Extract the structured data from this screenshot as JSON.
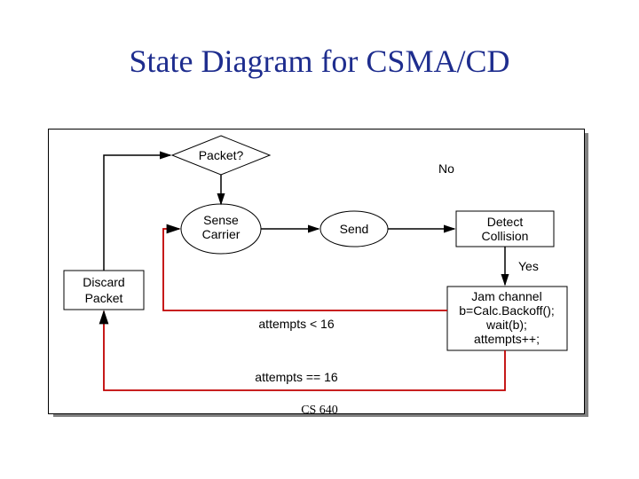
{
  "title": "State Diagram for CSMA/CD",
  "footer": "CS 640",
  "nodes": {
    "packet": "Packet?",
    "sense1": "Sense",
    "sense2": "Carrier",
    "send": "Send",
    "detect1": "Detect",
    "detect2": "Collision",
    "discard1": "Discard",
    "discard2": "Packet",
    "jam1": "Jam channel",
    "jam2": "b=Calc.Backoff();",
    "jam3": "wait(b);",
    "jam4": "attempts++;"
  },
  "edges": {
    "no": "No",
    "yes": "Yes",
    "lt16": "attempts < 16",
    "eq16": "attempts == 16"
  }
}
